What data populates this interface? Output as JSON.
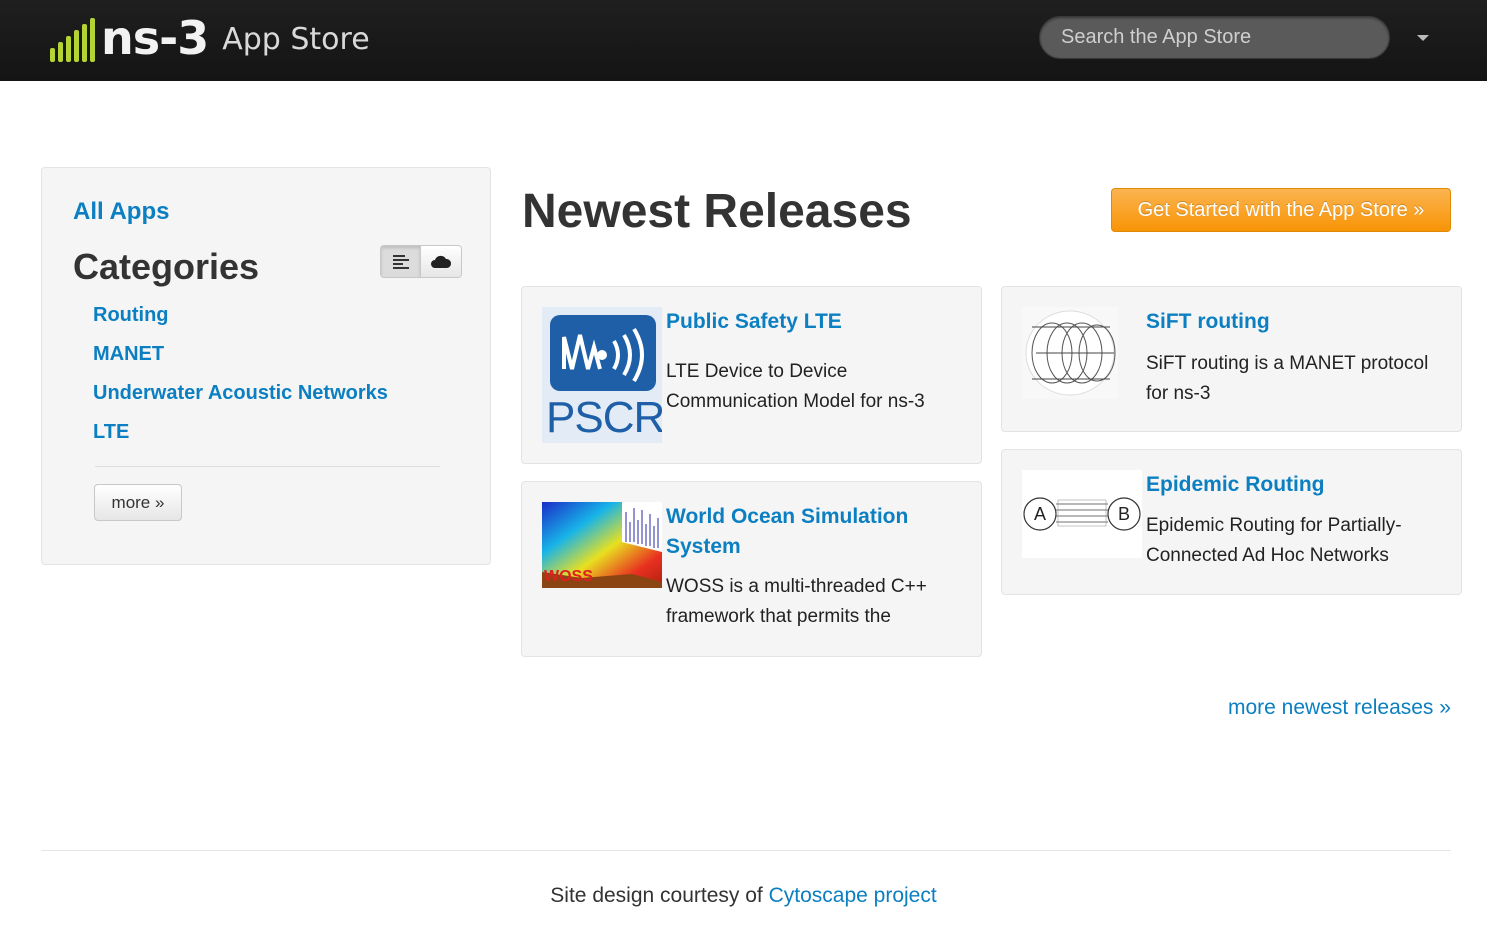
{
  "header": {
    "logo_text": "ns-3",
    "logo_subtitle": "App Store",
    "search_placeholder": "Search the App Store",
    "accent_color": "#b4d334"
  },
  "sidebar": {
    "all_apps": "All Apps",
    "categories_title": "Categories",
    "view_toggle": [
      "list-icon",
      "cloud-icon"
    ],
    "categories": [
      {
        "label": "Routing"
      },
      {
        "label": "MANET"
      },
      {
        "label": "Underwater Acoustic Networks"
      },
      {
        "label": "LTE"
      }
    ],
    "more_label": "more »"
  },
  "main": {
    "title": "Newest Releases",
    "cta_label": "Get Started with the App Store »",
    "cta_color": "#f89406",
    "apps": [
      {
        "name": "Public Safety LTE",
        "description": "LTE Device to Device Communication Model for ns-3",
        "thumb_text": "PSCR"
      },
      {
        "name": "SiFT routing",
        "description": "SiFT routing is a MANET protocol for ns-3"
      },
      {
        "name": "World Ocean Simulation System",
        "description": "WOSS is a multi-threaded C++ framework that permits the",
        "thumb_text": "WOSS"
      },
      {
        "name": "Epidemic Routing",
        "description": "Epidemic Routing for Partially-Connected Ad Hoc Networks",
        "thumb_nodes": [
          "A",
          "B"
        ]
      }
    ],
    "more_releases": "more newest releases »"
  },
  "footer": {
    "text": "Site design courtesy of",
    "link": "Cytoscape project",
    "link_color": "#0b7fc1"
  }
}
